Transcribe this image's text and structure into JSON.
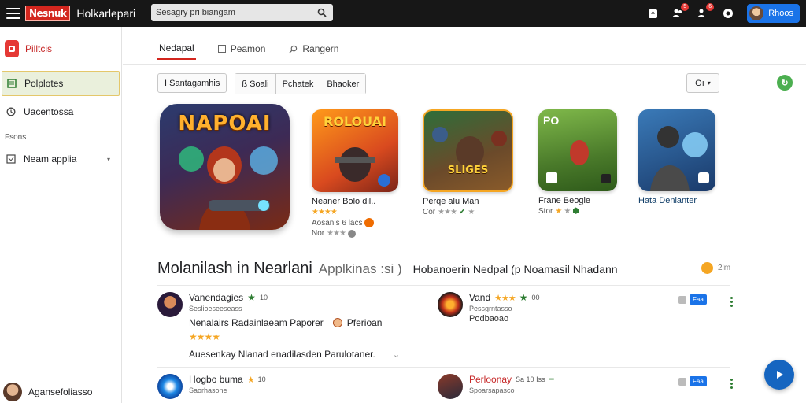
{
  "topbar": {
    "logo_text": "Nesnuk",
    "app_title": "Holkarlepari",
    "search_value": "Sesagry pri biangam",
    "account_label": "Rhoos",
    "badges": [
      "5",
      "6"
    ]
  },
  "sidebar": {
    "brand": "Pilltcis",
    "items": [
      {
        "label": "Polplotes",
        "icon": "grid-icon",
        "active": true
      },
      {
        "label": "Uacentossa",
        "icon": "history-icon",
        "active": false
      }
    ],
    "section": "Fsons",
    "sub_item": "Neam applia",
    "user": "Agansefoliasso"
  },
  "tabs": [
    {
      "label": "Nedapal",
      "active": true
    },
    {
      "label": "Peamon",
      "active": false
    },
    {
      "label": "Rangern",
      "active": false
    }
  ],
  "filters": {
    "first": "I Santagamhis",
    "group": [
      "ß Soali",
      "Pchatek",
      "Bhaoker"
    ],
    "sort": "Oı"
  },
  "featured": {
    "title": "NAPOAI"
  },
  "cards": [
    {
      "banner": "ROLOUAI",
      "name": "Neaner Bolo dil..",
      "sub1": "Aosanis 6 lacs",
      "sub2": "Nor"
    },
    {
      "banner": "SLIGES",
      "name": "Perqe alu Man",
      "sub1": "Cor"
    },
    {
      "banner": "PO",
      "name": "Frane Beogie",
      "sub1": "Stor"
    },
    {
      "banner": "",
      "name": "Hata Denlanter"
    }
  ],
  "section": {
    "title": "Molanilash in Nearlani",
    "subtitle": "Applkinas :si )",
    "extra": "Hobanoerin Nedpal (p Noamasil Nhadann",
    "right": "2lm"
  },
  "reviews": [
    {
      "name": "Vanendagies",
      "count": "10",
      "meta": "Seslioeseeseass",
      "text": "Nenalairs Radainlaeam Paporer",
      "tag": "Pferioan",
      "text2": "Auesenkay Nlanad enadilasden Parulotaner."
    },
    {
      "name": "Vand",
      "count": "00",
      "meta": "Pessgrntasso",
      "text": "Podbaoao"
    },
    {
      "name": "Hogbo buma",
      "count": "10",
      "meta": "Saorhasone"
    },
    {
      "name": "Perloonay",
      "count": "Sa 10 Iss",
      "meta": "Spoarsapasco"
    }
  ],
  "colors": {
    "accent": "#d3261e",
    "brand_blue": "#1a73e8",
    "topbar": "#171717",
    "active_bg": "#eaf0dc"
  }
}
